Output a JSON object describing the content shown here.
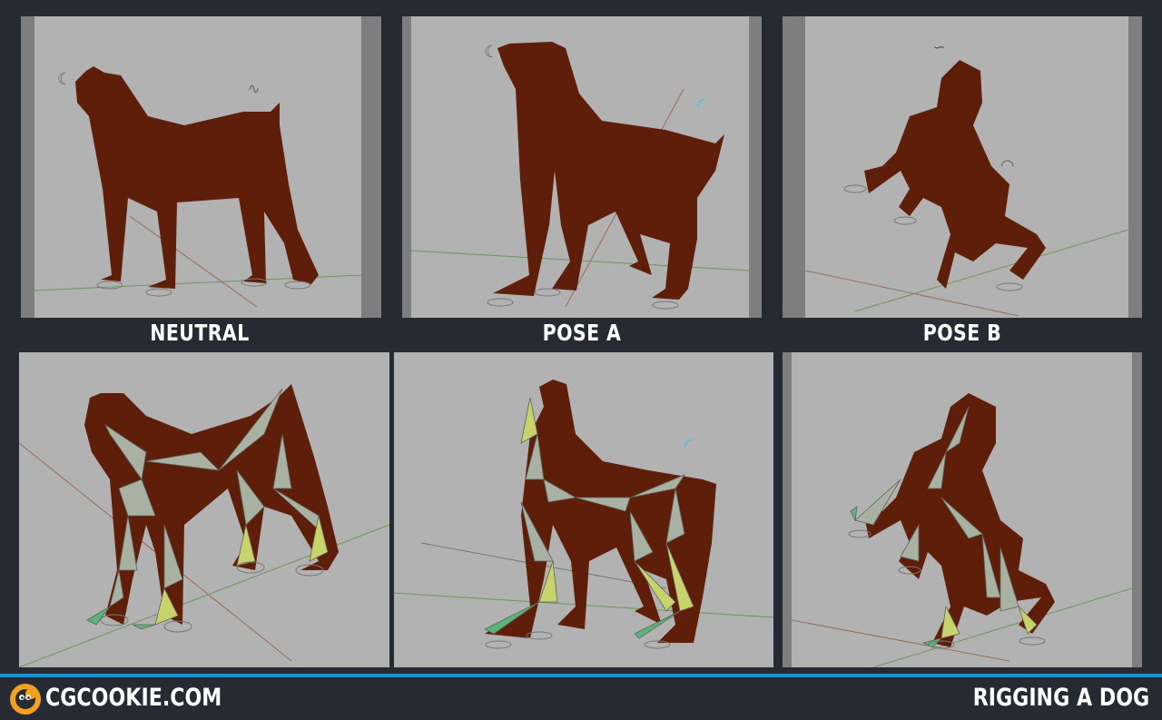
{
  "panels": {
    "top": [
      {
        "caption": "NEUTRAL"
      },
      {
        "caption": "POSE A"
      },
      {
        "caption": "POSE B"
      }
    ]
  },
  "footer": {
    "brand": "CGCOOKIE.COM",
    "title": "RIGGING A DOG",
    "accent_color": "#1f8fcf",
    "logo_icon": "cgcookie-logo-icon"
  },
  "colors": {
    "background": "#262a33",
    "viewport": "#b2b2b2",
    "dog": "#5e1e0a",
    "bone": "#a9b1a3"
  }
}
